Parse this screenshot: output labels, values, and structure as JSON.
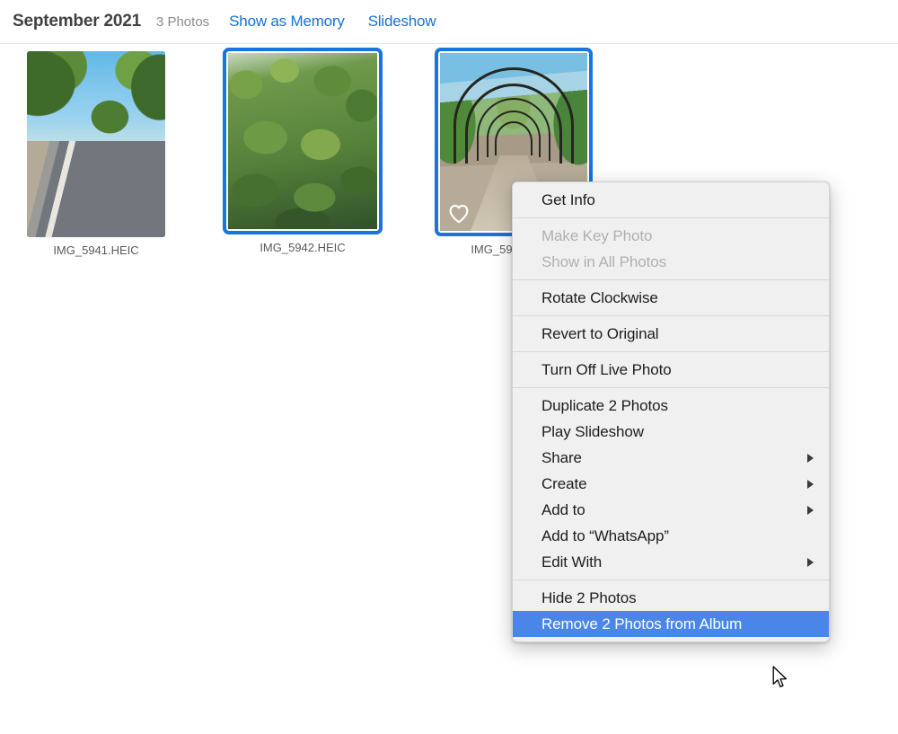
{
  "header": {
    "title": "September 2021",
    "photo_count": "3 Photos",
    "links": [
      {
        "label": "Show as Memory"
      },
      {
        "label": "Slideshow"
      }
    ],
    "link_color": "#1471d8"
  },
  "grid": {
    "photos": [
      {
        "filename": "IMG_5941.HEIC",
        "selected": false,
        "favorite": false,
        "alt": "road curving through green trees under blue sky"
      },
      {
        "filename": "IMG_5942.HEIC",
        "selected": true,
        "favorite": false,
        "alt": "dense green bushes and undergrowth"
      },
      {
        "filename": "IMG_5943.HEIC",
        "selected": true,
        "favorite": true,
        "alt": "metal pergola archway over a gravel path"
      }
    ],
    "selection_color": "#1675e0"
  },
  "context_menu": {
    "highlight_color": "#4a85e8",
    "groups": [
      {
        "items": [
          {
            "label": "Get Info",
            "disabled": false,
            "submenu": false,
            "highlighted": false
          }
        ]
      },
      {
        "items": [
          {
            "label": "Make Key Photo",
            "disabled": true,
            "submenu": false,
            "highlighted": false
          },
          {
            "label": "Show in All Photos",
            "disabled": true,
            "submenu": false,
            "highlighted": false
          }
        ]
      },
      {
        "items": [
          {
            "label": "Rotate Clockwise",
            "disabled": false,
            "submenu": false,
            "highlighted": false
          }
        ]
      },
      {
        "items": [
          {
            "label": "Revert to Original",
            "disabled": false,
            "submenu": false,
            "highlighted": false
          }
        ]
      },
      {
        "items": [
          {
            "label": "Turn Off Live Photo",
            "disabled": false,
            "submenu": false,
            "highlighted": false
          }
        ]
      },
      {
        "items": [
          {
            "label": "Duplicate 2 Photos",
            "disabled": false,
            "submenu": false,
            "highlighted": false
          },
          {
            "label": "Play Slideshow",
            "disabled": false,
            "submenu": false,
            "highlighted": false
          },
          {
            "label": "Share",
            "disabled": false,
            "submenu": true,
            "highlighted": false
          },
          {
            "label": "Create",
            "disabled": false,
            "submenu": true,
            "highlighted": false
          },
          {
            "label": "Add to",
            "disabled": false,
            "submenu": true,
            "highlighted": false
          },
          {
            "label": "Add to “WhatsApp”",
            "disabled": false,
            "submenu": false,
            "highlighted": false
          },
          {
            "label": "Edit With",
            "disabled": false,
            "submenu": true,
            "highlighted": false
          }
        ]
      },
      {
        "items": [
          {
            "label": "Hide 2 Photos",
            "disabled": false,
            "submenu": false,
            "highlighted": false
          },
          {
            "label": "Remove 2 Photos from Album",
            "disabled": false,
            "submenu": false,
            "highlighted": true
          }
        ]
      }
    ]
  },
  "icons": {
    "favorite": "heart-icon",
    "submenu": "chevron-right-icon",
    "pointer": "arrow-cursor-icon"
  }
}
